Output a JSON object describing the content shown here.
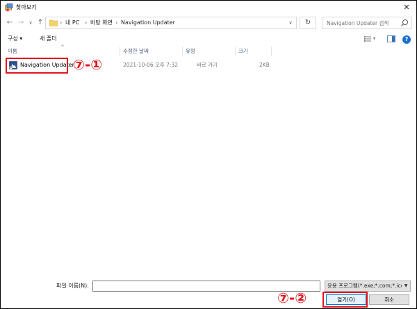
{
  "window": {
    "title": "찾아보기"
  },
  "nav": {
    "breadcrumbs": [
      "내 PC",
      "바탕 화면",
      "Navigation Updater"
    ],
    "search_placeholder": "Navigation Updater 검색"
  },
  "toolbar": {
    "organize_label": "구성 ▾",
    "new_folder_label": "새 폴더"
  },
  "columns": {
    "name": "이름",
    "date": "수정한 날짜",
    "type": "유형",
    "size": "크기"
  },
  "files": [
    {
      "name": "Navigation Updater",
      "date": "2021-10-06 오후 7:32",
      "type": "바로 가기",
      "size": "2KB"
    }
  ],
  "annotations": {
    "step1": "⑦-①",
    "step2": "⑦-②"
  },
  "footer": {
    "filename_label": "파일 이름(N):",
    "filename_value": "",
    "filetype_value": "응용 프로그램(*.exe;*.com;*.icd",
    "open_label": "열기(O)",
    "cancel_label": "취소"
  },
  "colors": {
    "highlight": "#e0141c",
    "accent": "#0078d7",
    "header_text": "#4c607a"
  },
  "icons": {
    "app": "app-window-icon",
    "close": "close-icon",
    "back": "arrow-left-icon",
    "forward": "arrow-right-icon",
    "up": "arrow-up-icon",
    "refresh": "refresh-icon",
    "search": "search-icon",
    "folder": "folder-icon",
    "help": "help-icon",
    "view": "view-options-icon",
    "preview": "preview-pane-icon",
    "shortcut": "shortcut-icon"
  }
}
